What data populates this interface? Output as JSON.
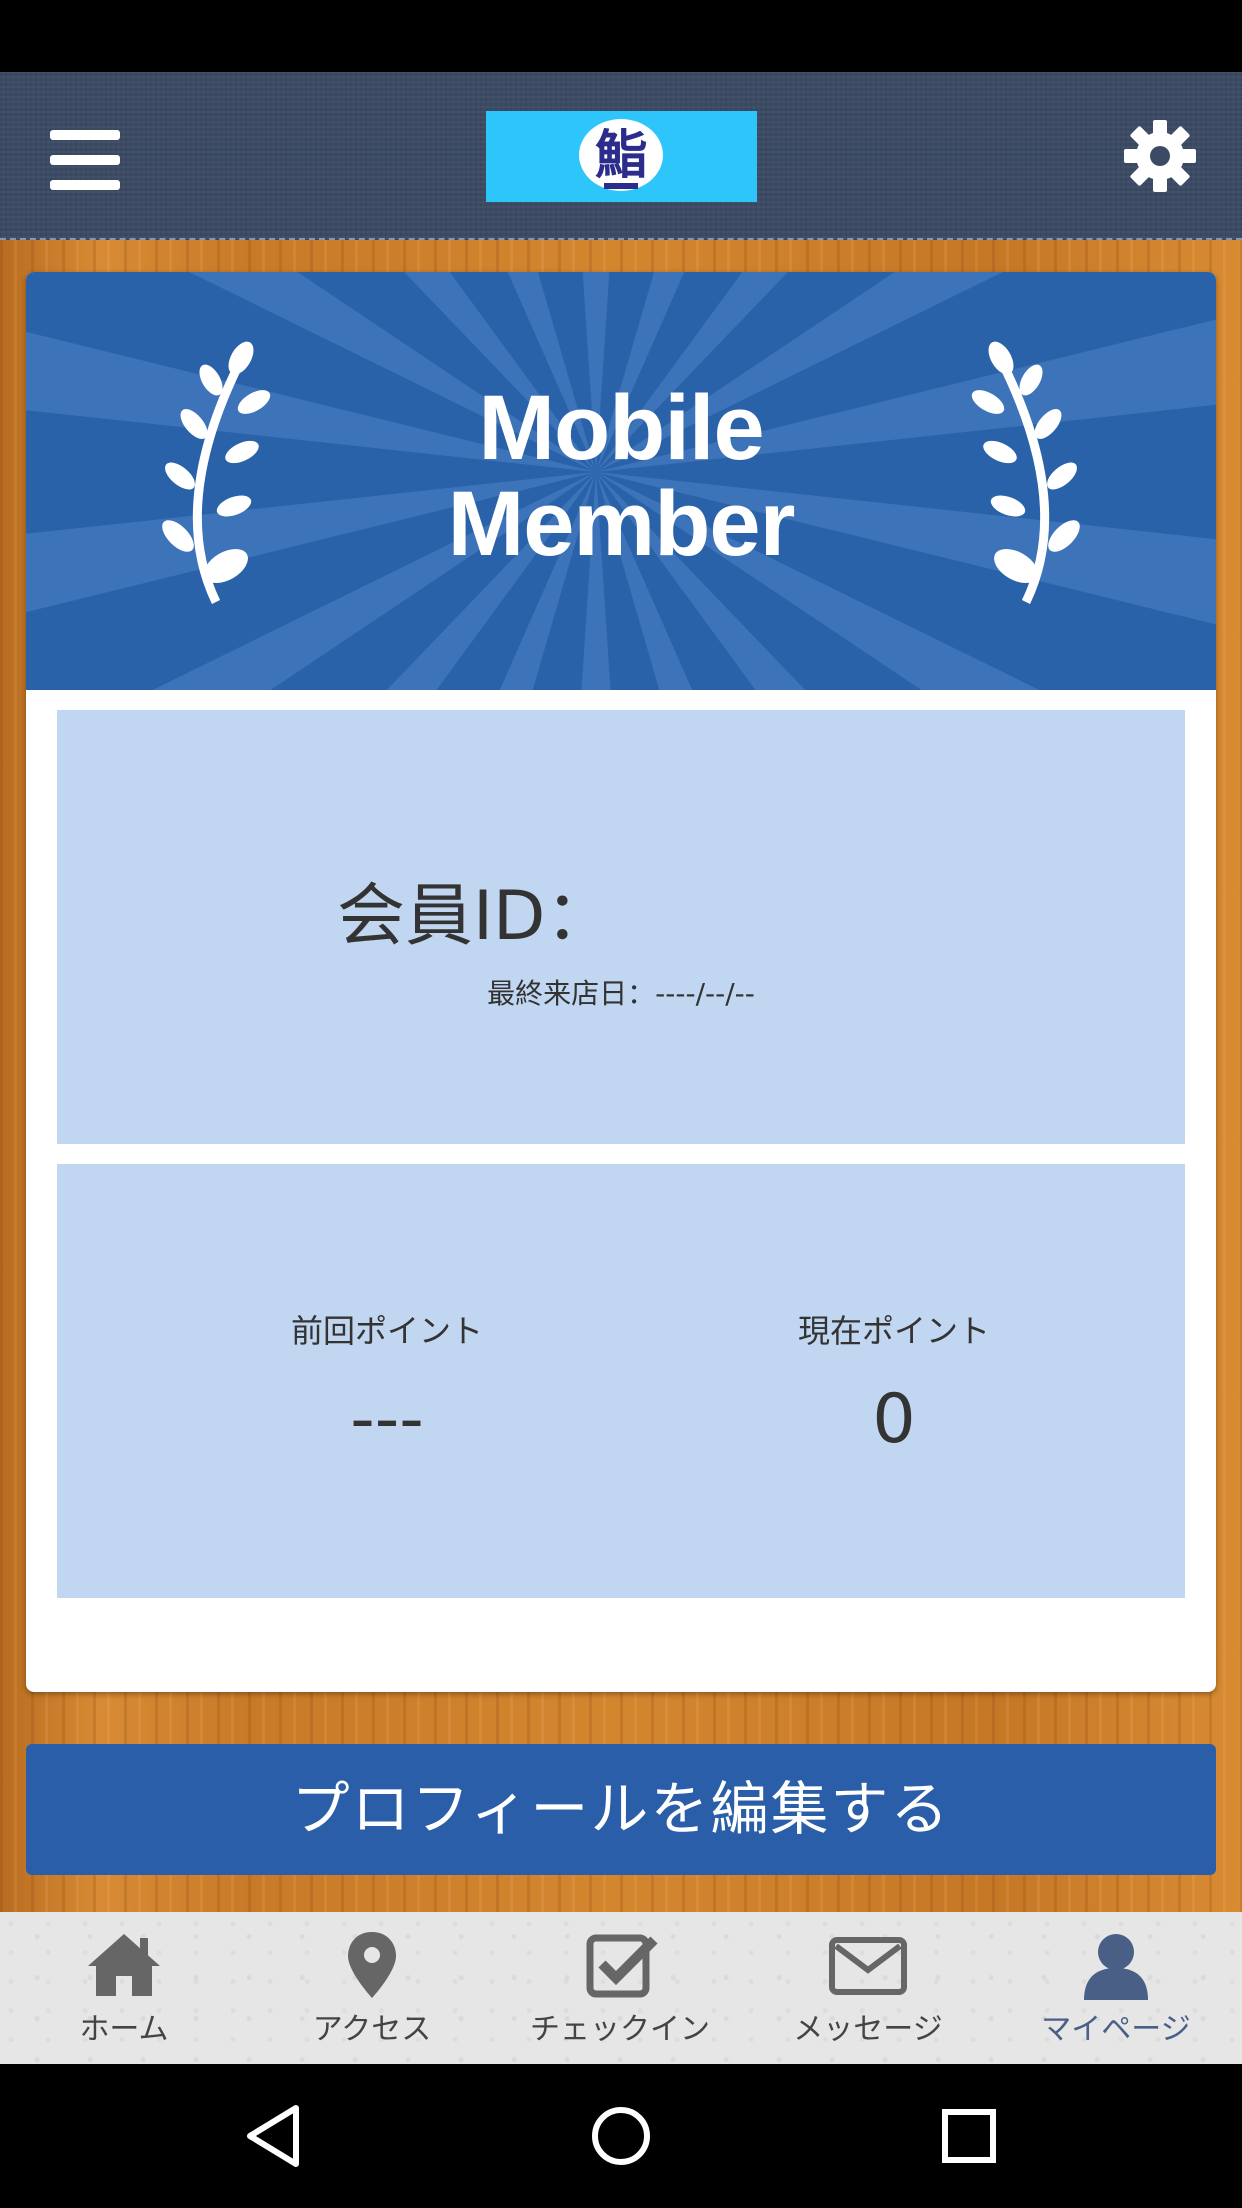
{
  "header": {
    "menu_icon": "hamburger-menu-icon",
    "logo_text": "鮨",
    "settings_icon": "gear-icon"
  },
  "banner": {
    "line1": "Mobile",
    "line2": "Member",
    "decoration": "laurel-branch-icon"
  },
  "member": {
    "id_label": "会員ID：",
    "last_visit_label": "最終来店日：",
    "last_visit_value": "----/--/--"
  },
  "points": {
    "previous_label": "前回ポイント",
    "previous_value": "---",
    "current_label": "現在ポイント",
    "current_value": "0"
  },
  "edit_profile_label": "プロフィールを編集する",
  "tabs": [
    {
      "label": "ホーム",
      "icon": "home-icon"
    },
    {
      "label": "アクセス",
      "icon": "map-pin-icon"
    },
    {
      "label": "チェックイン",
      "icon": "checkbox-icon"
    },
    {
      "label": "メッセージ",
      "icon": "envelope-icon"
    },
    {
      "label": "マイページ",
      "icon": "user-icon",
      "active": true
    }
  ],
  "colors": {
    "header": "#3b4b64",
    "banner": "#2a62aa",
    "panel": "#c1d6f0",
    "button": "#2a5ea8",
    "logo_bg": "#2ec5fb",
    "active_tab": "#4a5f86"
  }
}
